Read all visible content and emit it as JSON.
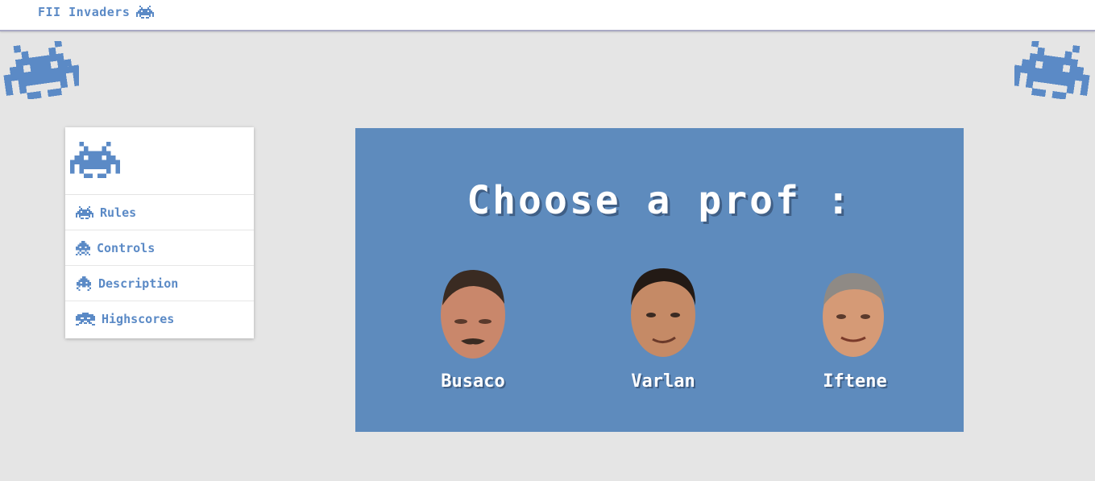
{
  "header": {
    "brand_label": "FII Invaders",
    "brand_icon": "space-invader-icon"
  },
  "colors": {
    "accent": "#5b8ac6",
    "panel": "#5e8bbd",
    "background": "#e5e5e5"
  },
  "sidebar": {
    "logo_icon": "space-invader-icon",
    "items": [
      {
        "label": "Rules",
        "icon": "crab-invader-icon"
      },
      {
        "label": "Controls",
        "icon": "squid-invader-icon"
      },
      {
        "label": "Description",
        "icon": "squid-invader-icon"
      },
      {
        "label": "Highscores",
        "icon": "octopus-invader-icon"
      }
    ]
  },
  "main": {
    "title": "Choose a prof :",
    "profs": [
      {
        "name": "Busaco"
      },
      {
        "name": "Varlan"
      },
      {
        "name": "Iftene"
      }
    ]
  }
}
